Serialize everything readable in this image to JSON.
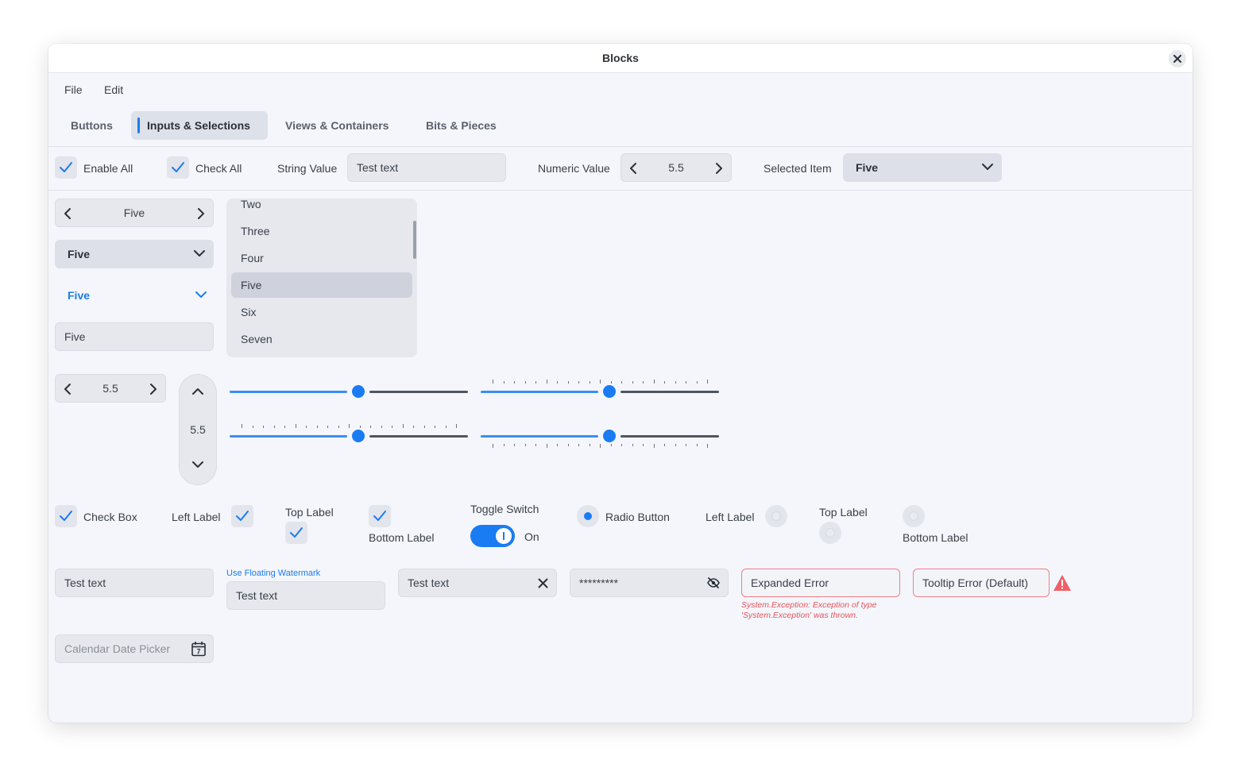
{
  "window": {
    "title": "Blocks"
  },
  "menu": {
    "file": "File",
    "edit": "Edit"
  },
  "tabs": [
    {
      "label": "Buttons"
    },
    {
      "label": "Inputs & Selections"
    },
    {
      "label": "Views & Containers"
    },
    {
      "label": "Bits & Pieces"
    }
  ],
  "toolbar": {
    "enable_all": "Enable All",
    "check_all": "Check All",
    "string_value_label": "String Value",
    "string_value": "Test text",
    "numeric_value_label": "Numeric Value",
    "numeric_value": "5.5",
    "selected_item_label": "Selected Item",
    "selected_item": "Five"
  },
  "selectors": {
    "cycle_value": "Five",
    "combo_value": "Five",
    "combo_blue_value": "Five",
    "editable_combo_value": "Five"
  },
  "listbox": {
    "items": [
      "Two",
      "Three",
      "Four",
      "Five",
      "Six",
      "Seven"
    ],
    "selected": "Five"
  },
  "numeric": {
    "horizontal": "5.5",
    "vertical": "5.5"
  },
  "sliders": {
    "value_fraction": 0.54
  },
  "checks": {
    "check_box": "Check Box",
    "left_label": "Left Label",
    "top_label": "Top Label",
    "bottom_label": "Bottom Label"
  },
  "toggle": {
    "label": "Toggle Switch",
    "state": "On"
  },
  "radios": {
    "radio_button": "Radio Button",
    "left_label": "Left Label",
    "top_label": "Top Label",
    "bottom_label": "Bottom Label"
  },
  "text_inputs": {
    "plain": "Test text",
    "floating_watermark": "Use Floating Watermark",
    "floating_value": "Test text",
    "clearable": "Test text",
    "password": "*********",
    "expanded_error": "Expanded Error",
    "error_message": "System.Exception: Exception of type 'System.Exception' was thrown.",
    "tooltip_error": "Tooltip Error (Default)",
    "date_picker_placeholder": "Calendar Date Picker",
    "calendar_day": "7"
  },
  "colors": {
    "accent": "#1a7cf2",
    "error": "#e8535c",
    "window_bg": "#f4f6fb"
  },
  "icons": [
    "close-icon",
    "chevron-left-icon",
    "chevron-right-icon",
    "chevron-down-icon",
    "chevron-up-icon",
    "check-icon",
    "clear-icon",
    "eye-off-icon",
    "warning-icon",
    "calendar-icon"
  ]
}
